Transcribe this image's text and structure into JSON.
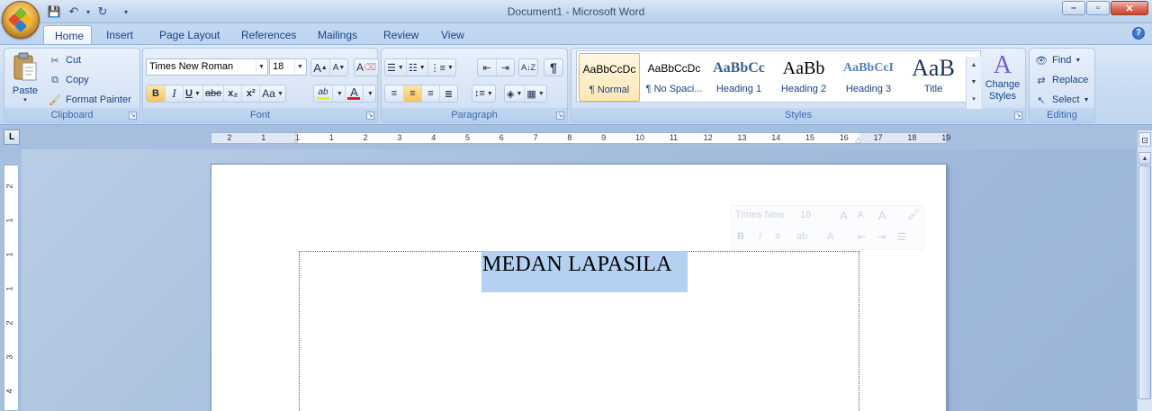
{
  "window": {
    "title_doc": "Document1",
    "title_sep": " - ",
    "title_app": "Microsoft Word",
    "controls": {
      "minimize": "–",
      "maximize": "▫",
      "close": "✕"
    }
  },
  "qat": {
    "save": "💾",
    "undo": "↶",
    "redo": "↻",
    "more": "▾"
  },
  "tabs": [
    "Home",
    "Insert",
    "Page Layout",
    "References",
    "Mailings",
    "Review",
    "View"
  ],
  "active_tab": "Home",
  "help_icon": "?",
  "clipboard": {
    "label": "Clipboard",
    "paste": "Paste",
    "cut": "Cut",
    "copy": "Copy",
    "format_painter": "Format Painter"
  },
  "font": {
    "label": "Font",
    "family": "Times New Roman",
    "size": "18",
    "bold": "B",
    "italic": "I",
    "underline": "U",
    "strike": "abe",
    "subscript": "x₂",
    "superscript": "x²",
    "change_case": "Aa",
    "grow": "A",
    "shrink": "A",
    "font_color": "A",
    "highlight": "ab",
    "clear": "A"
  },
  "paragraph": {
    "label": "Paragraph",
    "pilcrow": "¶",
    "sort": "A↓Z"
  },
  "styles": {
    "label": "Styles",
    "items": [
      {
        "sample": "AaBbCcDc",
        "name": "¶ Normal"
      },
      {
        "sample": "AaBbCcDc",
        "name": "¶ No Spaci..."
      },
      {
        "sample": "AaBbCc",
        "name": "Heading 1"
      },
      {
        "sample": "AaBb",
        "name": "Heading 2"
      },
      {
        "sample": "AaBbCcI",
        "name": "Heading 3"
      },
      {
        "sample": "AaB",
        "name": "Title"
      }
    ],
    "change_styles": "Change Styles"
  },
  "editing": {
    "label": "Editing",
    "find": "Find",
    "replace": "Replace",
    "select": "Select"
  },
  "ruler": {
    "numbers": [
      "2",
      "1",
      "1",
      "1",
      "2",
      "3",
      "4",
      "5",
      "6",
      "7",
      "8",
      "9",
      "10",
      "11",
      "12",
      "13",
      "14",
      "15",
      "16",
      "17",
      "18",
      "19"
    ],
    "tab_selector": "L",
    "vertical_numbers": [
      "2",
      "1",
      "1",
      "1",
      "2",
      "3",
      "4"
    ]
  },
  "document": {
    "heading_text": "MEDAN LAPASILA"
  },
  "mini_toolbar": {
    "font": "Times New",
    "size": "18"
  },
  "colors": {
    "accent": "#15428b",
    "ribbon": "#dbe7f6",
    "selection": "#b3d1f3",
    "font_color_bar": "#e21b1b",
    "highlight_bar": "#f2f20a"
  }
}
